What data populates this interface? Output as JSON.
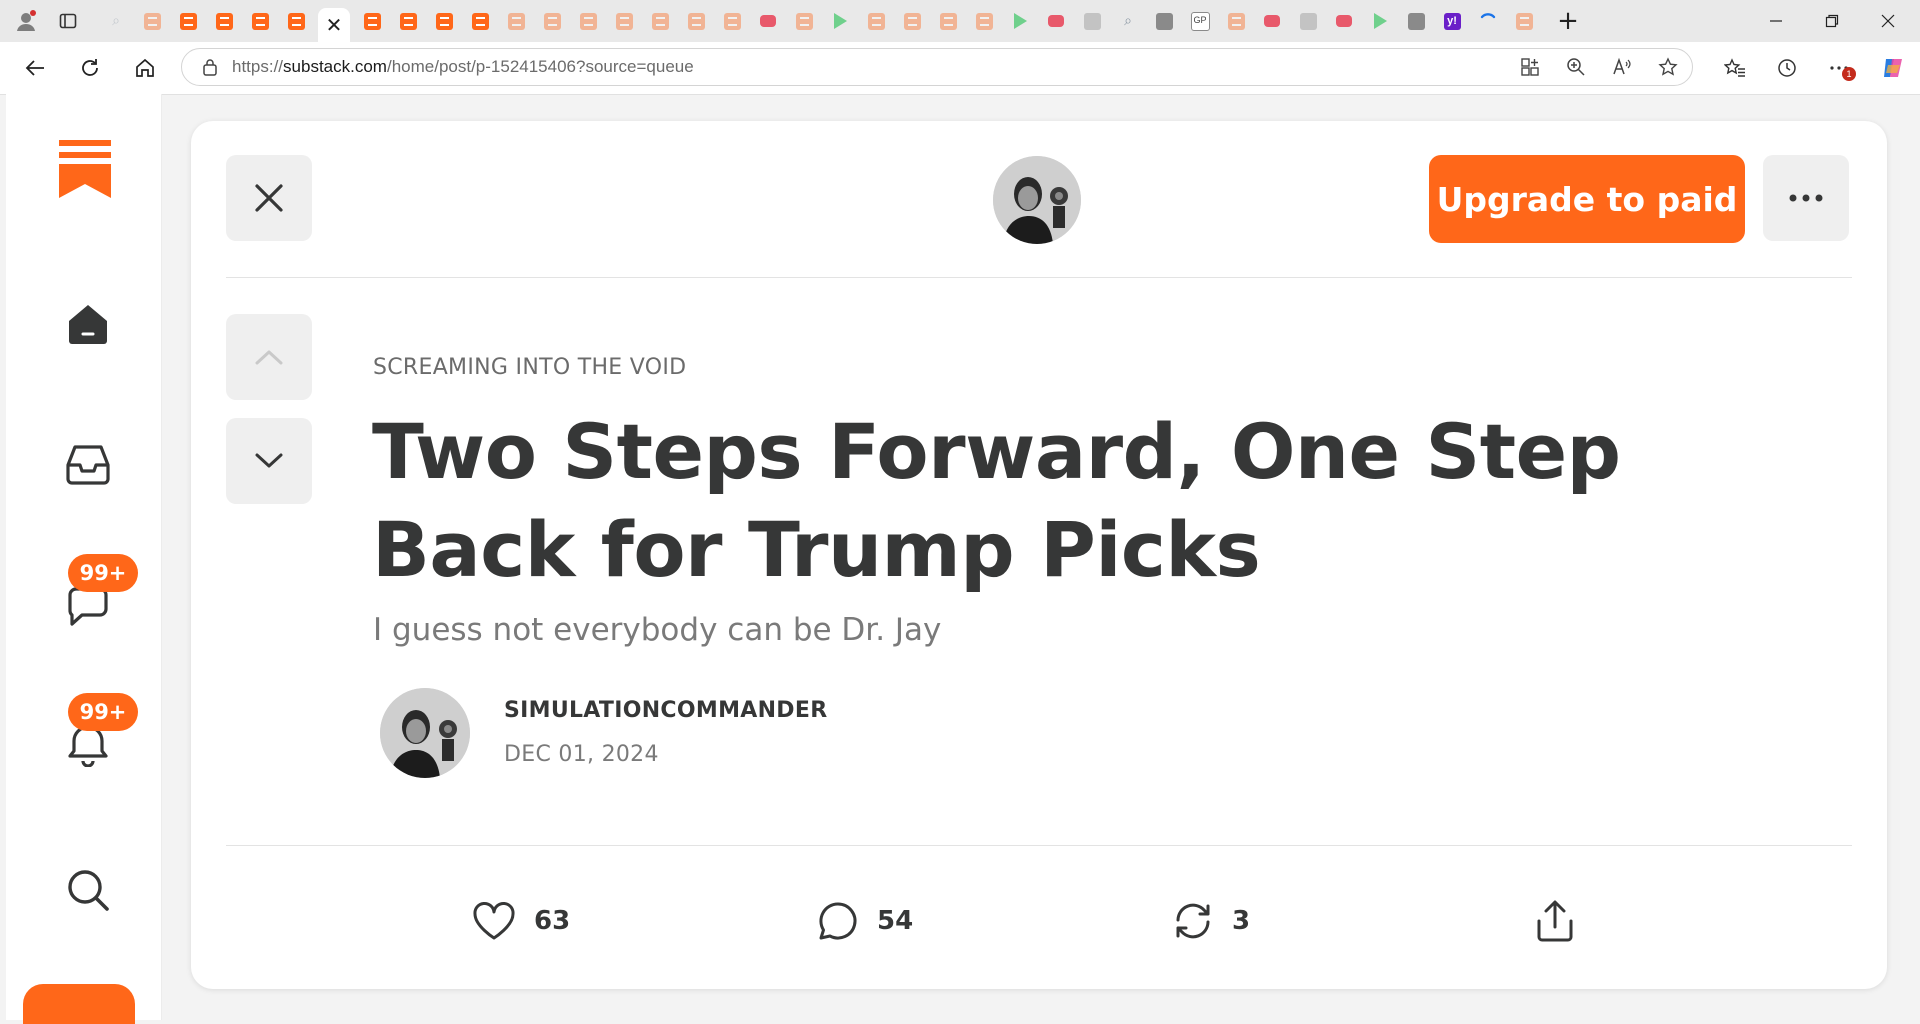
{
  "browser": {
    "url_prefix": "https://",
    "url_host": "substack.com",
    "url_path": "/home/post/p-152415406?source=queue",
    "active_tab_close": "✕",
    "new_tab": "+",
    "notification_count": "1"
  },
  "leftnav": {
    "chat_badge": "99+",
    "activity_badge": "99+"
  },
  "post": {
    "upgrade_label": "Upgrade to paid",
    "publication": "SCREAMING INTO THE VOID",
    "title": "Two Steps Forward, One Step Back for Trump Picks",
    "subtitle": "I guess not everybody can be Dr. Jay",
    "author": "SIMULATIONCOMMANDER",
    "date": "DEC 01, 2024",
    "likes": "63",
    "comments": "54",
    "restacks": "3"
  },
  "colors": {
    "accent": "#ff6719",
    "text": "#363737",
    "muted": "#7a7a7a"
  }
}
